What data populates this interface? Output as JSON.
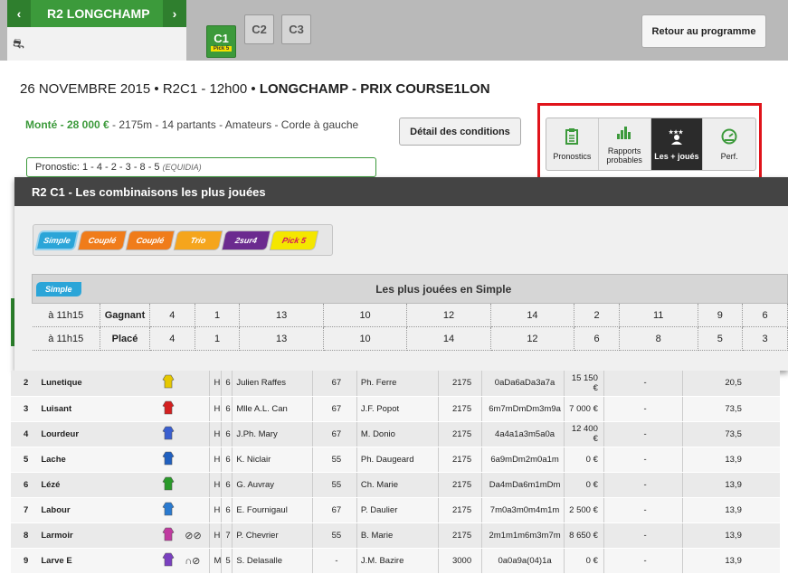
{
  "header": {
    "reunion_title": "R2 LONGCHAMP",
    "prev_icon": "chevron-left",
    "next_icon": "chevron-right",
    "sulky_icon": "sulky-icon",
    "course_tabs": [
      {
        "label": "C1",
        "sub": "Pick 5",
        "active": true
      },
      {
        "label": "C2",
        "active": false
      },
      {
        "label": "C3",
        "active": false
      }
    ],
    "back_button": "Retour au programme"
  },
  "race": {
    "date_code": "26 NOVEMBRE 2015 • R2C1 - 12h00 • ",
    "name": "LONGCHAMP - PRIX COURSE1LON",
    "discipline_prize": "Monté - 28 000 €",
    "details": " - 2175m - 14 partants - Amateurs - Corde à gauche",
    "conditions_button": "Détail des conditions",
    "prono_label": "Pronostic: ",
    "prono_values": "1 - 4 - 2 - 3 - 8 - 5",
    "prono_source": "(EQUIDIA)"
  },
  "tools": [
    {
      "label": "Pronostics",
      "icon": "clipboard-icon",
      "glyph": "📋",
      "active": false
    },
    {
      "label": "Rapports probables",
      "icon": "bars-icon",
      "glyph": "▮",
      "active": false
    },
    {
      "label": "Les + joués",
      "icon": "user-stars-icon",
      "glyph": "★",
      "active": true
    },
    {
      "label": "Perf.",
      "icon": "gauge-icon",
      "glyph": "◔",
      "active": false
    }
  ],
  "overlay": {
    "title": "R2 C1 - Les combinaisons les plus jouées",
    "bet_types": [
      {
        "label": "Simple",
        "cls": "simple"
      },
      {
        "label": "Couplé",
        "cls": "couple"
      },
      {
        "label": "Couplé",
        "cls": "coupleo"
      },
      {
        "label": "Trio",
        "cls": "trio"
      },
      {
        "label": "2sur4",
        "cls": "deux"
      },
      {
        "label": "Pick 5",
        "cls": "pick"
      }
    ],
    "table_badge": "Simple",
    "table_title": "Les plus jouées en Simple",
    "rows": [
      {
        "time": "à 11h15",
        "type": "Gagnant",
        "values": [
          "4",
          "1",
          "13",
          "10",
          "12",
          "14",
          "2",
          "11",
          "9",
          "6"
        ]
      },
      {
        "time": "à 11h15",
        "type": "Placé",
        "values": [
          "4",
          "1",
          "13",
          "10",
          "14",
          "12",
          "6",
          "8",
          "5",
          "3"
        ]
      }
    ]
  },
  "runners": [
    {
      "num": "2",
      "name": "Lunetique",
      "shoes": "",
      "sex": "H",
      "age": "6",
      "driver": "Julien Raffes",
      "weight": "67",
      "trainer": "Ph. Ferre",
      "dist": "2175",
      "music": "0aDa6aDa3a7a",
      "gains": "15 150 €",
      "odds1": "-",
      "odds2": "20,5"
    },
    {
      "num": "3",
      "name": "Luisant",
      "shoes": "",
      "sex": "H",
      "age": "6",
      "driver": "Mlle A.L. Can",
      "weight": "67",
      "trainer": "J.F. Popot",
      "dist": "2175",
      "music": "6m7mDmDm3m9a",
      "gains": "7 000 €",
      "odds1": "-",
      "odds2": "73,5"
    },
    {
      "num": "4",
      "name": "Lourdeur",
      "shoes": "",
      "sex": "H",
      "age": "6",
      "driver": "J.Ph. Mary",
      "weight": "67",
      "trainer": "M. Donio",
      "dist": "2175",
      "music": "4a4a1a3m5a0a",
      "gains": "12 400 €",
      "odds1": "-",
      "odds2": "73,5"
    },
    {
      "num": "5",
      "name": "Lache",
      "shoes": "",
      "sex": "H",
      "age": "6",
      "driver": "K. Niclair",
      "weight": "55",
      "trainer": "Ph. Daugeard",
      "dist": "2175",
      "music": "6a9mDm2m0a1m",
      "gains": "0 €",
      "odds1": "-",
      "odds2": "13,9"
    },
    {
      "num": "6",
      "name": "Lézé",
      "shoes": "",
      "sex": "H",
      "age": "6",
      "driver": "G. Auvray",
      "weight": "55",
      "trainer": "Ch. Marie",
      "dist": "2175",
      "music": "Da4mDa6m1mDm",
      "gains": "0 €",
      "odds1": "-",
      "odds2": "13,9"
    },
    {
      "num": "7",
      "name": "Labour",
      "shoes": "",
      "sex": "H",
      "age": "6",
      "driver": "E. Fournigaul",
      "weight": "67",
      "trainer": "P. Daulier",
      "dist": "2175",
      "music": "7m0a3m0m4m1m",
      "gains": "2 500 €",
      "odds1": "-",
      "odds2": "13,9"
    },
    {
      "num": "8",
      "name": "Larmoir",
      "shoes": "⊘⊘",
      "sex": "H",
      "age": "7",
      "driver": "P. Chevrier",
      "weight": "55",
      "trainer": "B. Marie",
      "dist": "2175",
      "music": "2m1m1m6m3m7m",
      "gains": "8 650 €",
      "odds1": "-",
      "odds2": "13,9"
    },
    {
      "num": "9",
      "name": "Larve E",
      "shoes": "∩⊘",
      "sex": "M",
      "age": "5",
      "driver": "S. Delasalle",
      "weight": "-",
      "trainer": "J.M. Bazire",
      "dist": "3000",
      "music": "0a0a9a(04)1a",
      "gains": "0 €",
      "odds1": "-",
      "odds2": "13,9"
    }
  ]
}
